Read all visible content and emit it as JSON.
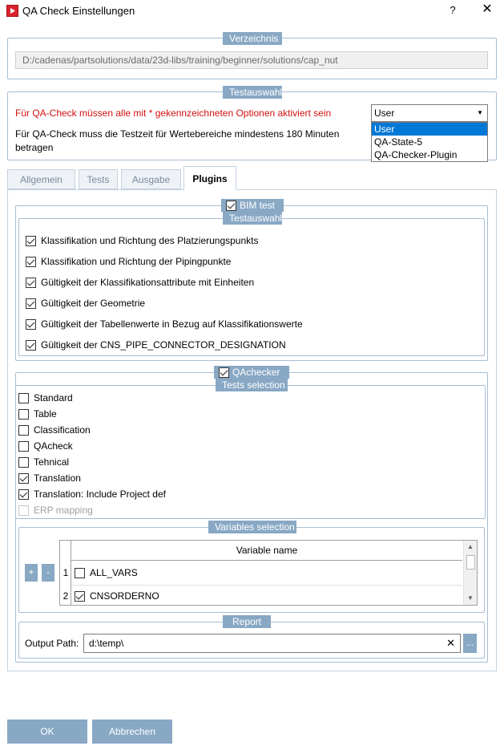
{
  "window": {
    "title": "QA Check Einstellungen",
    "help_label": "?",
    "close_label": "✕"
  },
  "verzeichnis": {
    "title": "Verzeichnis",
    "path": "D:/cadenas/partsolutions/data/23d-libs/training/beginner/solutions/cap_nut"
  },
  "testauswahl": {
    "title": "Testauswahl",
    "warning": "Für QA-Check müssen alle mit * gekennzeichneten Optionen aktiviert sein",
    "note_line1": "Für QA-Check muss die Testzeit für Wertebereiche mindestens 180 Minuten",
    "note_line2": "betragen",
    "dropdown": {
      "value": "User",
      "options": [
        "User",
        "QA-State-5",
        "QA-Checker-Plugin"
      ]
    }
  },
  "tabs": [
    {
      "label": "Allgemein"
    },
    {
      "label": "Tests"
    },
    {
      "label": "Ausgabe"
    },
    {
      "label": "Plugins"
    }
  ],
  "bimtest": {
    "title": "BIM test",
    "checked": true,
    "sub_title": "Testauswahl",
    "items": [
      {
        "label": "Klassifikation und Richtung des Platzierungspunkts",
        "checked": true
      },
      {
        "label": "Klassifikation und Richtung der Pipingpunkte",
        "checked": true
      },
      {
        "label": "Gültigkeit der Klassifikationsattribute mit Einheiten",
        "checked": true
      },
      {
        "label": "Gültigkeit der Geometrie",
        "checked": true
      },
      {
        "label": "Gültigkeit der Tabellenwerte in Bezug auf Klassifikationswerte",
        "checked": true
      },
      {
        "label": "Gültigkeit der CNS_PIPE_CONNECTOR_DESIGNATION",
        "checked": true
      }
    ]
  },
  "qachecker": {
    "title": "QAchecker",
    "checked": true,
    "tests_title": "Tests selection",
    "tests": [
      {
        "label": "Standard",
        "checked": false
      },
      {
        "label": "Table",
        "checked": false
      },
      {
        "label": "Classification",
        "checked": false
      },
      {
        "label": "QAcheck",
        "checked": false
      },
      {
        "label": "Tehnical",
        "checked": false
      },
      {
        "label": "Translation",
        "checked": true
      },
      {
        "label": "Translation: Include Project def",
        "checked": true
      },
      {
        "label": "ERP mapping",
        "checked": false,
        "disabled": true
      }
    ],
    "vars_title": "Variables selection",
    "add_label": "+",
    "remove_label": "-",
    "vars_header": "Variable name",
    "vars": [
      {
        "num": "1",
        "name": "ALL_VARS",
        "checked": false
      },
      {
        "num": "2",
        "name": "CNSORDERNO",
        "checked": true
      }
    ],
    "report_title": "Report",
    "output_label": "Output Path:",
    "output_value": "d:\\temp\\",
    "clear_label": "✕",
    "browse_label": "..."
  },
  "buttons": {
    "ok": "OK",
    "cancel": "Abbrechen"
  }
}
